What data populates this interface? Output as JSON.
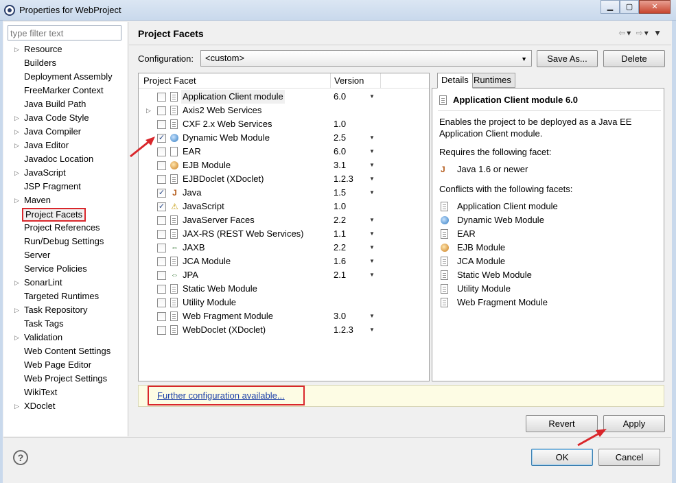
{
  "window": {
    "title": "Properties for WebProject",
    "minimize": "▁",
    "maximize": "▢",
    "close": "✕"
  },
  "filter": {
    "placeholder": "type filter text"
  },
  "tree": [
    {
      "label": "Resource",
      "expandable": true
    },
    {
      "label": "Builders",
      "expandable": false
    },
    {
      "label": "Deployment Assembly",
      "expandable": false
    },
    {
      "label": "FreeMarker Context",
      "expandable": false
    },
    {
      "label": "Java Build Path",
      "expandable": false
    },
    {
      "label": "Java Code Style",
      "expandable": true
    },
    {
      "label": "Java Compiler",
      "expandable": true
    },
    {
      "label": "Java Editor",
      "expandable": true
    },
    {
      "label": "Javadoc Location",
      "expandable": false
    },
    {
      "label": "JavaScript",
      "expandable": true
    },
    {
      "label": "JSP Fragment",
      "expandable": false
    },
    {
      "label": "Maven",
      "expandable": true
    },
    {
      "label": "Project Facets",
      "expandable": false,
      "selected": true
    },
    {
      "label": "Project References",
      "expandable": false
    },
    {
      "label": "Run/Debug Settings",
      "expandable": false
    },
    {
      "label": "Server",
      "expandable": false
    },
    {
      "label": "Service Policies",
      "expandable": false
    },
    {
      "label": "SonarLint",
      "expandable": true
    },
    {
      "label": "Targeted Runtimes",
      "expandable": false
    },
    {
      "label": "Task Repository",
      "expandable": true
    },
    {
      "label": "Task Tags",
      "expandable": false
    },
    {
      "label": "Validation",
      "expandable": true
    },
    {
      "label": "Web Content Settings",
      "expandable": false
    },
    {
      "label": "Web Page Editor",
      "expandable": false
    },
    {
      "label": "Web Project Settings",
      "expandable": false
    },
    {
      "label": "WikiText",
      "expandable": false
    },
    {
      "label": "XDoclet",
      "expandable": true
    }
  ],
  "page": {
    "title": "Project Facets",
    "config_label": "Configuration:",
    "config_value": "<custom>",
    "save_as": "Save As...",
    "delete": "Delete"
  },
  "facet_table": {
    "col_facet": "Project Facet",
    "col_version": "Version",
    "rows": [
      {
        "name": "Application Client module",
        "version": "6.0",
        "checked": false,
        "icon": "doc",
        "dropdown": true,
        "expand": false,
        "highlight": true
      },
      {
        "name": "Axis2 Web Services",
        "version": "",
        "checked": false,
        "icon": "doc",
        "dropdown": false,
        "expand": true
      },
      {
        "name": "CXF 2.x Web Services",
        "version": "1.0",
        "checked": false,
        "icon": "doc",
        "dropdown": false,
        "expand": false
      },
      {
        "name": "Dynamic Web Module",
        "version": "2.5",
        "checked": true,
        "icon": "globe",
        "dropdown": true,
        "expand": false
      },
      {
        "name": "EAR",
        "version": "6.0",
        "checked": false,
        "icon": "ear",
        "dropdown": true,
        "expand": false
      },
      {
        "name": "EJB Module",
        "version": "3.1",
        "checked": false,
        "icon": "bean",
        "dropdown": true,
        "expand": false
      },
      {
        "name": "EJBDoclet (XDoclet)",
        "version": "1.2.3",
        "checked": false,
        "icon": "doc",
        "dropdown": true,
        "expand": false
      },
      {
        "name": "Java",
        "version": "1.5",
        "checked": true,
        "icon": "java",
        "dropdown": true,
        "expand": false
      },
      {
        "name": "JavaScript",
        "version": "1.0",
        "checked": true,
        "icon": "js",
        "dropdown": false,
        "expand": false
      },
      {
        "name": "JavaServer Faces",
        "version": "2.2",
        "checked": false,
        "icon": "doc",
        "dropdown": true,
        "expand": false
      },
      {
        "name": "JAX-RS (REST Web Services)",
        "version": "1.1",
        "checked": false,
        "icon": "doc",
        "dropdown": true,
        "expand": false
      },
      {
        "name": "JAXB",
        "version": "2.2",
        "checked": false,
        "icon": "jax",
        "dropdown": true,
        "expand": false
      },
      {
        "name": "JCA Module",
        "version": "1.6",
        "checked": false,
        "icon": "doc",
        "dropdown": true,
        "expand": false
      },
      {
        "name": "JPA",
        "version": "2.1",
        "checked": false,
        "icon": "jax",
        "dropdown": true,
        "expand": false
      },
      {
        "name": "Static Web Module",
        "version": "",
        "checked": false,
        "icon": "doc",
        "dropdown": false,
        "expand": false
      },
      {
        "name": "Utility Module",
        "version": "",
        "checked": false,
        "icon": "doc",
        "dropdown": false,
        "expand": false
      },
      {
        "name": "Web Fragment Module",
        "version": "3.0",
        "checked": false,
        "icon": "doc",
        "dropdown": true,
        "expand": false
      },
      {
        "name": "WebDoclet (XDoclet)",
        "version": "1.2.3",
        "checked": false,
        "icon": "doc",
        "dropdown": true,
        "expand": false
      }
    ]
  },
  "details": {
    "tab_details": "Details",
    "tab_runtimes": "Runtimes",
    "title": "Application Client module 6.0",
    "description": "Enables the project to be deployed as a Java EE Application Client module.",
    "requires_label": "Requires the following facet:",
    "requires": [
      {
        "name": "Java 1.6 or newer",
        "icon": "java"
      }
    ],
    "conflicts_label": "Conflicts with the following facets:",
    "conflicts": [
      {
        "name": "Application Client module",
        "icon": "doc"
      },
      {
        "name": "Dynamic Web Module",
        "icon": "globe"
      },
      {
        "name": "EAR",
        "icon": "doc"
      },
      {
        "name": "EJB Module",
        "icon": "bean"
      },
      {
        "name": "JCA Module",
        "icon": "doc"
      },
      {
        "name": "Static Web Module",
        "icon": "doc"
      },
      {
        "name": "Utility Module",
        "icon": "doc"
      },
      {
        "name": "Web Fragment Module",
        "icon": "doc"
      }
    ]
  },
  "further": {
    "link": "Further configuration available..."
  },
  "buttons": {
    "revert": "Revert",
    "apply": "Apply",
    "ok": "OK",
    "cancel": "Cancel",
    "help": "?"
  },
  "colors": {
    "annotation_red": "#d9262b",
    "link_blue": "#1b3fa8",
    "info_bar": "#fdfce4"
  }
}
